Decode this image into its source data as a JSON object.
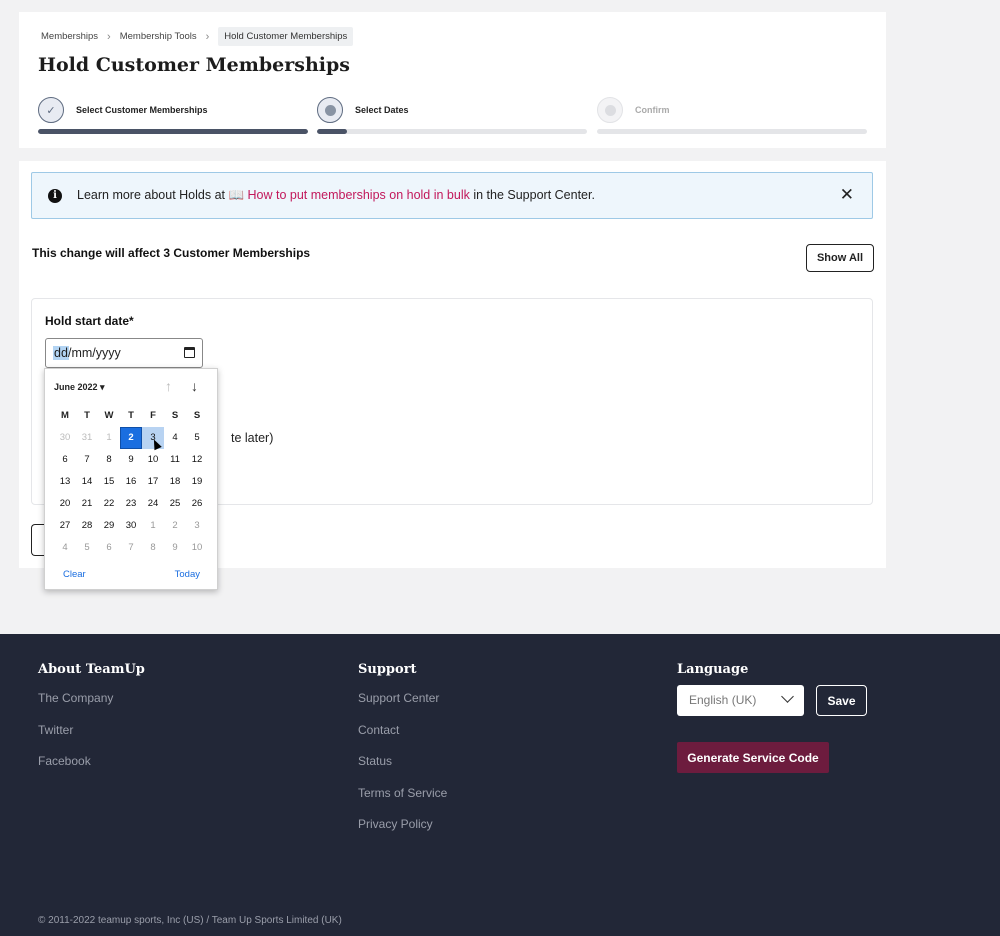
{
  "breadcrumb": {
    "items": [
      "Memberships",
      "Membership Tools"
    ],
    "current": "Hold Customer Memberships"
  },
  "page": {
    "title": "Hold Customer Memberships"
  },
  "steps": [
    {
      "label": "Select Customer Memberships",
      "status": "complete",
      "progress": 1.0
    },
    {
      "label": "Select Dates",
      "status": "active",
      "progress": 0.11
    },
    {
      "label": "Confirm",
      "status": "inactive",
      "progress": 0.0
    }
  ],
  "info": {
    "prefix": "Learn more about Holds at 📖 ",
    "link": "How to put memberships on hold in bulk",
    "suffix": " in the Support Center.",
    "close_icon": "close-icon"
  },
  "affect": {
    "text": "This change will affect 3 Customer Memberships",
    "show_all_label": "Show All"
  },
  "form": {
    "start_label": "Hold start date*",
    "date_dd": "dd",
    "date_rest": "/mm/yyyy",
    "partial_text": "te later)"
  },
  "calendar": {
    "month_label": "June 2022 ▾",
    "up_arrow": "↑",
    "down_arrow": "↓",
    "weekdays": [
      "M",
      "T",
      "W",
      "T",
      "F",
      "S",
      "S"
    ],
    "days": [
      {
        "d": "30",
        "s": "disabled"
      },
      {
        "d": "31",
        "s": "disabled"
      },
      {
        "d": "1",
        "s": "disabled"
      },
      {
        "d": "2",
        "s": "selected"
      },
      {
        "d": "3",
        "s": "hover"
      },
      {
        "d": "4",
        "s": ""
      },
      {
        "d": "5",
        "s": ""
      },
      {
        "d": "6",
        "s": ""
      },
      {
        "d": "7",
        "s": ""
      },
      {
        "d": "8",
        "s": ""
      },
      {
        "d": "9",
        "s": ""
      },
      {
        "d": "10",
        "s": ""
      },
      {
        "d": "11",
        "s": ""
      },
      {
        "d": "12",
        "s": ""
      },
      {
        "d": "13",
        "s": ""
      },
      {
        "d": "14",
        "s": ""
      },
      {
        "d": "15",
        "s": ""
      },
      {
        "d": "16",
        "s": ""
      },
      {
        "d": "17",
        "s": ""
      },
      {
        "d": "18",
        "s": ""
      },
      {
        "d": "19",
        "s": ""
      },
      {
        "d": "20",
        "s": ""
      },
      {
        "d": "21",
        "s": ""
      },
      {
        "d": "22",
        "s": ""
      },
      {
        "d": "23",
        "s": ""
      },
      {
        "d": "24",
        "s": ""
      },
      {
        "d": "25",
        "s": ""
      },
      {
        "d": "26",
        "s": ""
      },
      {
        "d": "27",
        "s": ""
      },
      {
        "d": "28",
        "s": ""
      },
      {
        "d": "29",
        "s": ""
      },
      {
        "d": "30",
        "s": ""
      },
      {
        "d": "1",
        "s": "muted"
      },
      {
        "d": "2",
        "s": "muted"
      },
      {
        "d": "3",
        "s": "muted"
      },
      {
        "d": "4",
        "s": "muted"
      },
      {
        "d": "5",
        "s": "muted"
      },
      {
        "d": "6",
        "s": "muted"
      },
      {
        "d": "7",
        "s": "muted"
      },
      {
        "d": "8",
        "s": "muted"
      },
      {
        "d": "9",
        "s": "muted"
      },
      {
        "d": "10",
        "s": "muted"
      }
    ],
    "clear_label": "Clear",
    "today_label": "Today"
  },
  "footer": {
    "about": {
      "heading": "About TeamUp",
      "links": [
        "The Company",
        "Twitter",
        "Facebook"
      ]
    },
    "support": {
      "heading": "Support",
      "links": [
        "Support Center",
        "Contact",
        "Status",
        "Terms of Service",
        "Privacy Policy"
      ]
    },
    "language": {
      "heading": "Language",
      "selected": "English (UK)",
      "save_label": "Save",
      "generate_label": "Generate Service Code"
    },
    "copyright": "© 2011-2022 teamup sports, Inc (US) / Team Up Sports Limited (UK)"
  },
  "colors": {
    "accent_link": "#c2185b",
    "calendar_selected": "#1a6ee0",
    "footer_bg": "#222737",
    "generate_button": "#6d1c3e"
  }
}
